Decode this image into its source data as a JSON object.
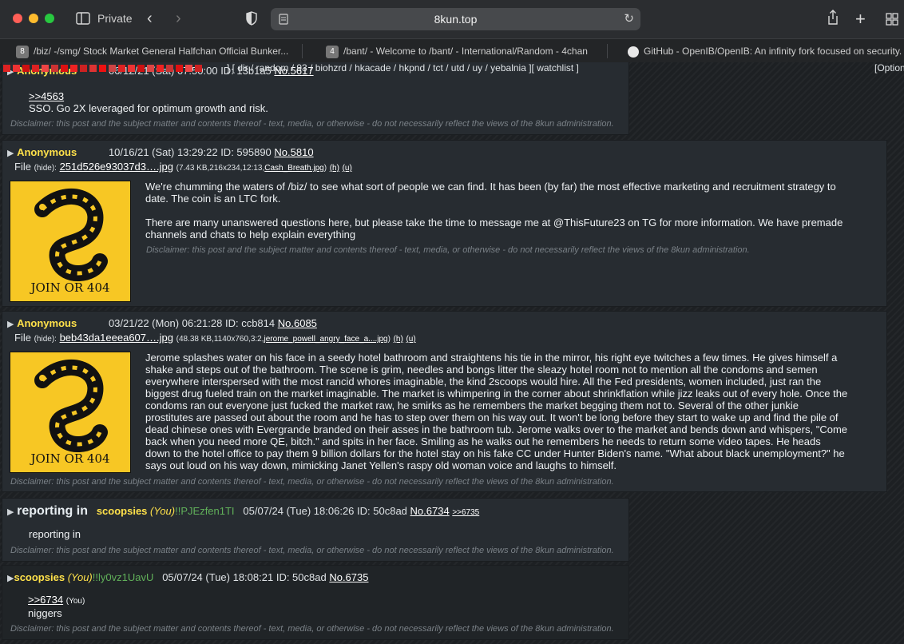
{
  "browser": {
    "private_label": "Private",
    "url": "8kun.top",
    "tabs": [
      {
        "badge": "8",
        "title": "/biz/ -/smg/ Stock Market General Halfchan Official Bunker..."
      },
      {
        "badge": "4",
        "title": "/bant/ - Welcome to /bant/ - International/Random - 4chan"
      },
      {
        "badge": "",
        "title": "GitHub - OpenIB/OpenIB: An infinity fork focused on security."
      }
    ]
  },
  "boardlist": {
    "text": "] [ dir / random / 93 / biohzrd / hkacade / hkpnd / tct / utd / uy / yebalnia ][ watchlist ]",
    "options": "[Option"
  },
  "disclaimer": "Disclaimer: this post and the subject matter and contents thereof - text, media, or otherwise - do not necessarily reflect the views of the 8kun administration.",
  "posts": [
    {
      "name": "Anonymous",
      "datetime": "06/12/21 (Sat) 07:50:00",
      "id": "ID: 13b1a5",
      "no": "No.5617",
      "quote": ">>4563",
      "body": "SSO. Go 2X leveraged for optimum growth and risk."
    },
    {
      "name": "Anonymous",
      "datetime": "10/16/21 (Sat) 13:29:22",
      "id": "ID: 595890",
      "no": "No.5810",
      "file_label": "File",
      "hide": "(hide):",
      "file_name": "251d526e93037d3….jpg",
      "file_meta": "(7.43 KB,216x234,12:13,",
      "file_orig": "Cash_Breath.jpg",
      "file_meta_end": ")",
      "h": "(h)",
      "u": "(u)",
      "thumb_text": "JOIN OR 404",
      "body1": "We're chumming the waters of /biz/ to see what sort of people we can find. It has been (by far) the most effective marketing and recruitment strategy to date. The coin is an LTC fork.",
      "body2": "There are many unanswered questions here, but please take the time to message me at @ThisFuture23 on TG for more information. We have premade channels and chats to help explain everything"
    },
    {
      "name": "Anonymous",
      "datetime": "03/21/22 (Mon) 06:21:28",
      "id": "ID: ccb814",
      "no": "No.6085",
      "file_label": "File",
      "hide": "(hide):",
      "file_name": "beb43da1eeea607….jpg",
      "file_meta": "(48.38 KB,1140x760,3:2,",
      "file_orig": "jerome_powell_angry_face_a....jpg",
      "file_meta_end": ")",
      "h": "(h)",
      "u": "(u)",
      "thumb_text": "JOIN OR 404",
      "body": "Jerome splashes water on his face in a seedy hotel bathroom and straightens his tie in the mirror, his right eye twitches a few times. He gives himself a shake and steps out of the bathroom. The scene is grim, needles and bongs litter the sleazy hotel room not to mention all the condoms and semen everywhere interspersed with the most rancid whores imaginable, the kind 2scoops would hire. All the Fed presidents, women included, just ran the biggest drug fueled train on the market imaginable. The market is whimpering in the corner about shrinkflation while jizz leaks out of every hole. Once the condoms ran out everyone just fucked the market raw, he smirks as he remembers the market begging them not to. Several of the other junkie prostitutes are passed out about the room and he has to step over them on his way out. It won't be long before they start to wake up and find the pile of dead chinese ones with Evergrande branded on their asses in the bathroom tub. Jerome walks over to the market and bends down and whispers, \"Come back when you need more QE, bitch.\" and spits in her face. Smiling as he walks out he remembers he needs to return some video tapes. He heads down to the hotel office to pay them 9 billion dollars for the hotel stay on his fake CC under Hunter Biden's name. \"What about black unemployment?\" he says out loud on his way down, mimicking Janet Yellen's raspy old woman voice and laughs to himself."
    },
    {
      "subject": "reporting in",
      "name": "scoopsies",
      "you": "(You)",
      "trip": "!!PJEzfen1TI",
      "datetime": "05/07/24 (Tue) 18:06:26",
      "id": "ID: 50c8ad",
      "no": "No.6734",
      "backlink": ">>6735",
      "body": "reporting in"
    },
    {
      "name": "scoopsies",
      "you": "(You)",
      "trip": "!!ly0vz1UavU",
      "datetime": "05/07/24 (Tue) 18:08:21",
      "id": "ID: 50c8ad",
      "no": "No.6735",
      "quote": ">>6734",
      "quote_you": "(You)",
      "body": "niggers"
    }
  ]
}
